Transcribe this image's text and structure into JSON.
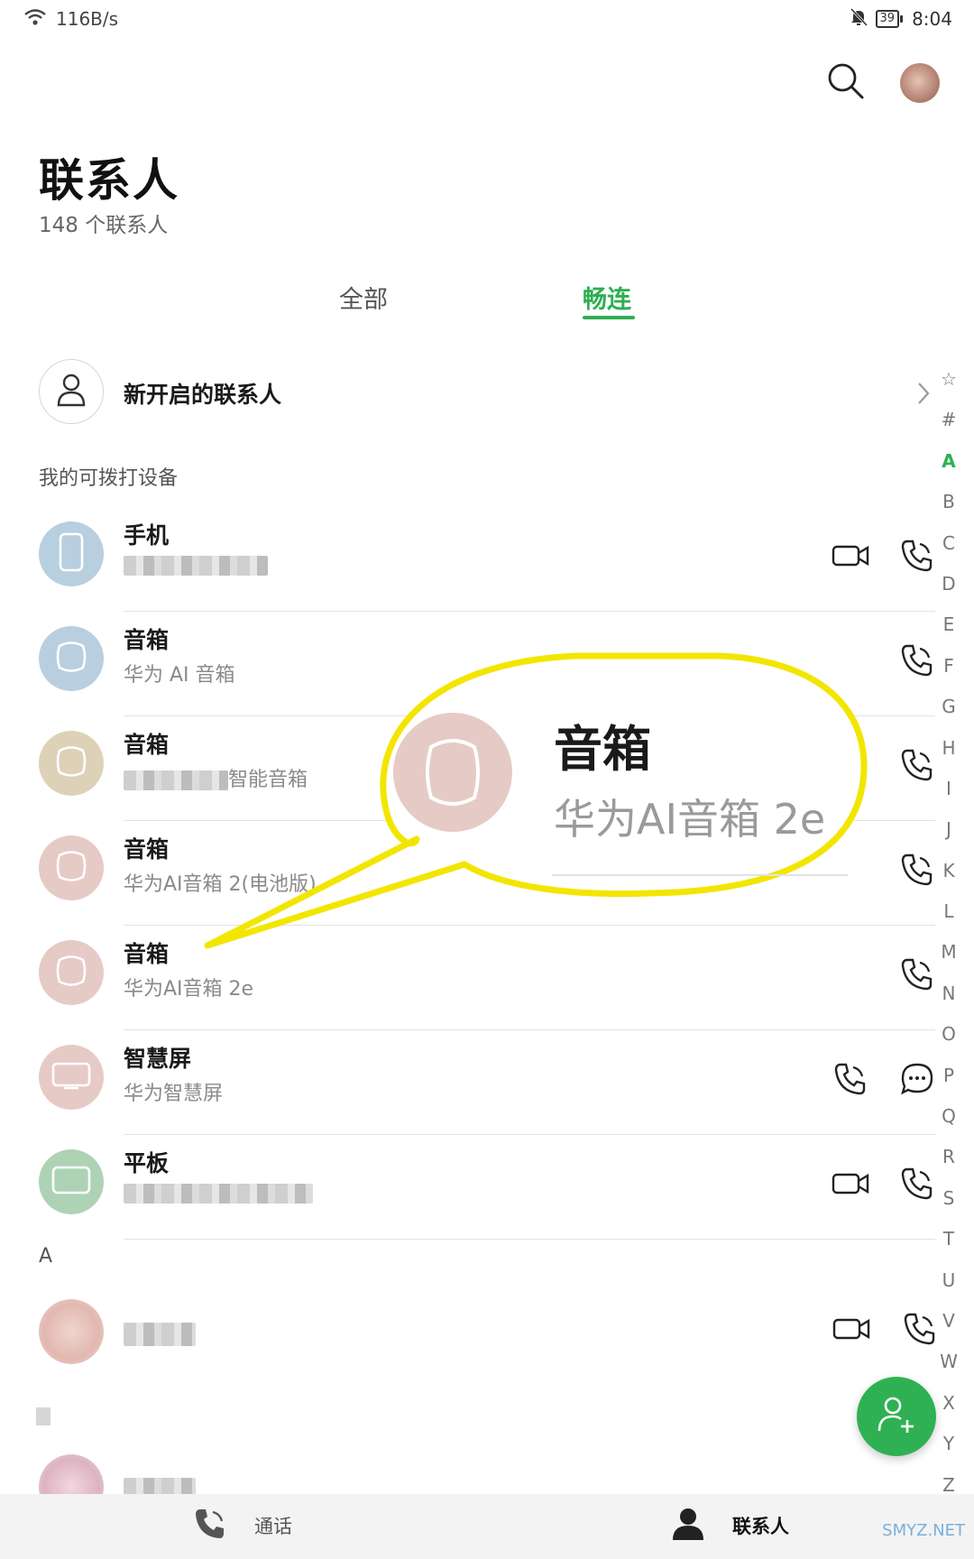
{
  "status_bar": {
    "net_speed": "116B/s",
    "battery": "39",
    "time": "8:04"
  },
  "header": {
    "title": "联系人",
    "count_text": "148 个联系人"
  },
  "tabs": [
    {
      "label": "全部",
      "active": false
    },
    {
      "label": "畅连",
      "active": true
    }
  ],
  "new_contacts_row": {
    "label": "新开启的联系人"
  },
  "devices_section": {
    "title": "我的可拨打设备"
  },
  "devices": [
    {
      "name": "手机",
      "subtitle": "",
      "icon": "phone-device-icon",
      "color": "#b7cfdf",
      "actions": [
        "video-call-icon",
        "phone-call-icon"
      ]
    },
    {
      "name": "音箱",
      "subtitle": "华为 AI 音箱",
      "icon": "speaker-icon",
      "color": "#b9cfdf",
      "actions": [
        "phone-call-icon"
      ]
    },
    {
      "name": "音箱",
      "subtitle": "智能音箱",
      "icon": "speaker-icon",
      "color": "#ddd2b8",
      "actions": [
        "phone-call-icon"
      ]
    },
    {
      "name": "音箱",
      "subtitle": "华为AI音箱 2(电池版)",
      "icon": "speaker-icon",
      "color": "#e6cac6",
      "actions": [
        "phone-call-icon"
      ]
    },
    {
      "name": "音箱",
      "subtitle": "华为AI音箱 2e",
      "icon": "speaker-icon",
      "color": "#e6cac6",
      "actions": [
        "phone-call-icon"
      ]
    },
    {
      "name": "智慧屏",
      "subtitle": "华为智慧屏",
      "icon": "tv-screen-icon",
      "color": "#e6cac6",
      "actions": [
        "phone-call-icon",
        "message-icon"
      ]
    },
    {
      "name": "平板",
      "subtitle": "",
      "icon": "tablet-icon",
      "color": "#aed3b4",
      "actions": [
        "video-call-icon",
        "phone-call-icon"
      ]
    }
  ],
  "alphabet_index": [
    "☆",
    "#",
    "A",
    "B",
    "C",
    "D",
    "E",
    "F",
    "G",
    "H",
    "I",
    "J",
    "K",
    "L",
    "M",
    "N",
    "O",
    "P",
    "Q",
    "R",
    "S",
    "T",
    "U",
    "V",
    "W",
    "X",
    "Y",
    "Z"
  ],
  "alphabet_active": "A",
  "letter_section": {
    "label": "A"
  },
  "callout": {
    "name": "音箱",
    "subtitle": "华为AI音箱 2e"
  },
  "bottom_nav": [
    {
      "label": "通话",
      "icon": "phone-call-icon",
      "active": false
    },
    {
      "label": "联系人",
      "icon": "person-icon",
      "active": true
    }
  ],
  "watermark": "SMYZ.NET",
  "colors": {
    "accent": "#2fae52",
    "fab": "#2fb153",
    "callout_border": "#f2e600"
  }
}
